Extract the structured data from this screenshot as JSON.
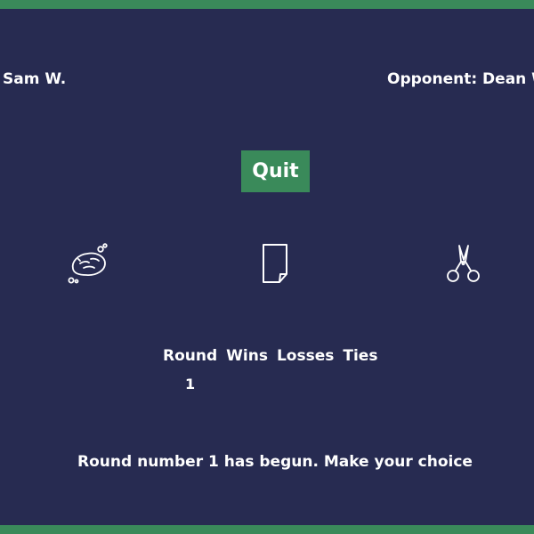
{
  "players": {
    "you": "Sam W.",
    "opponent": "Opponent: Dean W."
  },
  "controls": {
    "quit_label": "Quit"
  },
  "choices": [
    {
      "name": "rock",
      "icon": "rock-icon"
    },
    {
      "name": "paper",
      "icon": "paper-icon"
    },
    {
      "name": "scissors",
      "icon": "scissors-icon"
    }
  ],
  "score": {
    "headers": [
      "Round",
      "Wins",
      "Losses",
      "Ties"
    ],
    "row": [
      "1",
      "",
      "",
      ""
    ]
  },
  "status": "Round number 1 has begun. Make your choice",
  "colors": {
    "background": "#272b51",
    "accent": "#3a8a5a",
    "text": "#ffffff"
  }
}
